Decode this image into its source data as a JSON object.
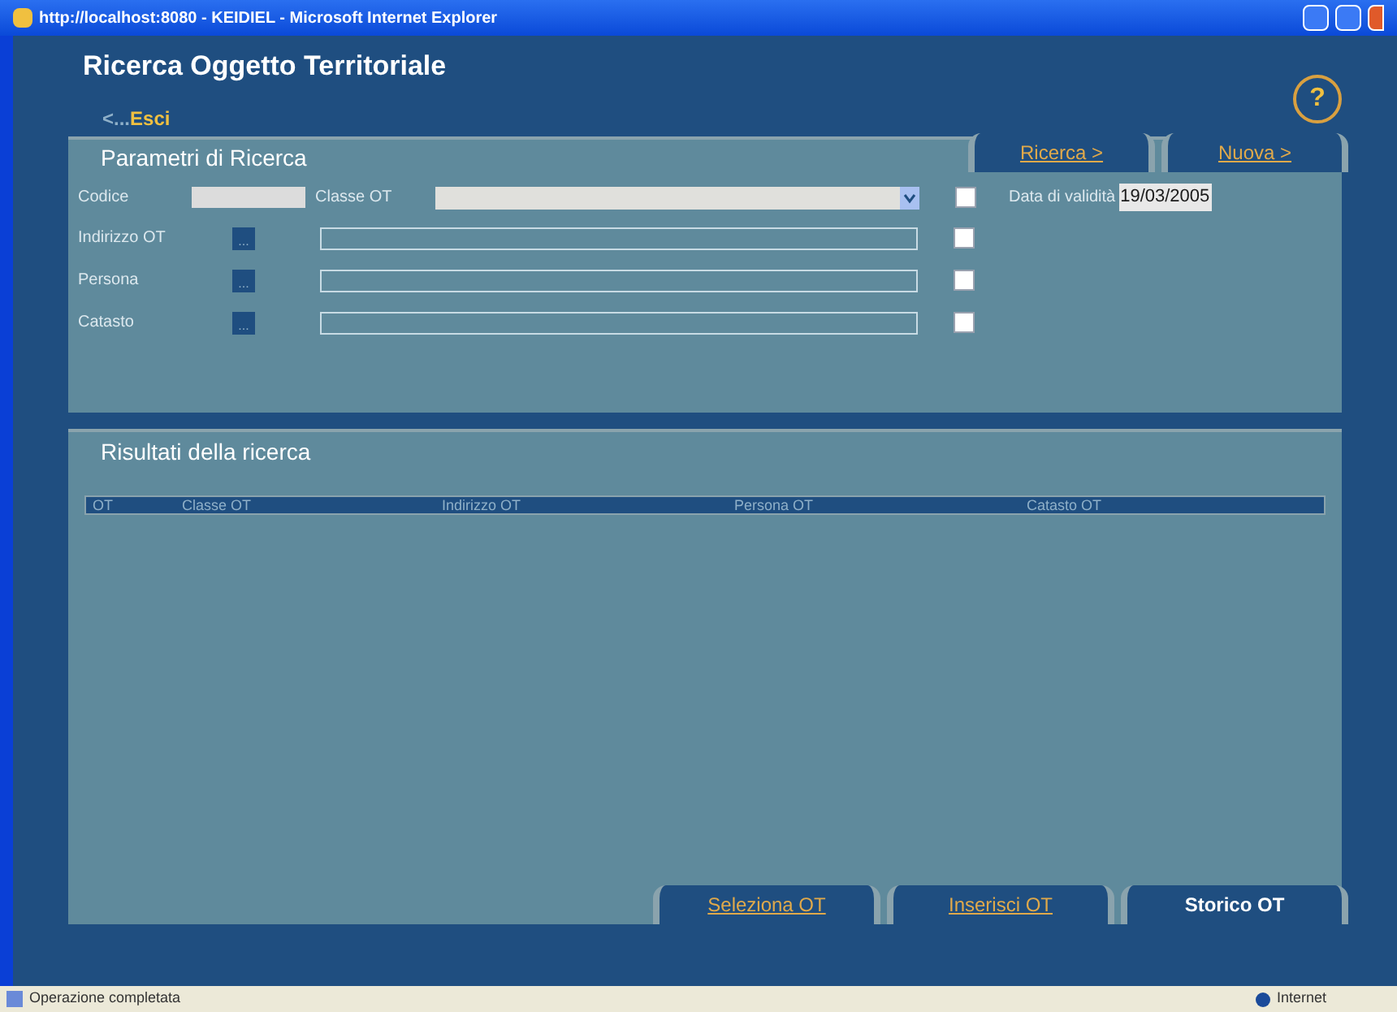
{
  "window": {
    "title": "http://localhost:8080 - KEIDIEL - Microsoft Internet Explorer"
  },
  "page": {
    "title": "Ricerca Oggetto Territoriale",
    "back_link": {
      "prefix": "<...",
      "label": "Esci"
    },
    "help": "?"
  },
  "search_panel": {
    "title": "Parametri di Ricerca",
    "tabs": [
      {
        "label": "Ricerca >",
        "selected": false
      },
      {
        "label": "Nuova >",
        "selected": false
      }
    ],
    "codice": {
      "label": "Codice"
    },
    "classe": {
      "label": "Classe OT",
      "checked": false
    },
    "validity": {
      "label": "Data di validità",
      "value": "19/03/2005"
    },
    "rows": [
      {
        "label": "Indirizzo OT",
        "button": "...",
        "checked": false
      },
      {
        "label": "Persona",
        "button": "...",
        "checked": false
      },
      {
        "label": "Catasto",
        "button": "...",
        "checked": false
      }
    ]
  },
  "results_panel": {
    "title": "Risultati della ricerca",
    "columns": [
      "OT",
      "Classe OT",
      "Indirizzo OT",
      "Persona OT",
      "Catasto OT"
    ],
    "tabs": [
      {
        "label": "Seleziona OT",
        "selected": false
      },
      {
        "label": "Inserisci OT",
        "selected": false
      },
      {
        "label": "Storico OT",
        "selected": true
      }
    ]
  },
  "status_bar": {
    "message": "Operazione completata",
    "zone": "Internet"
  }
}
